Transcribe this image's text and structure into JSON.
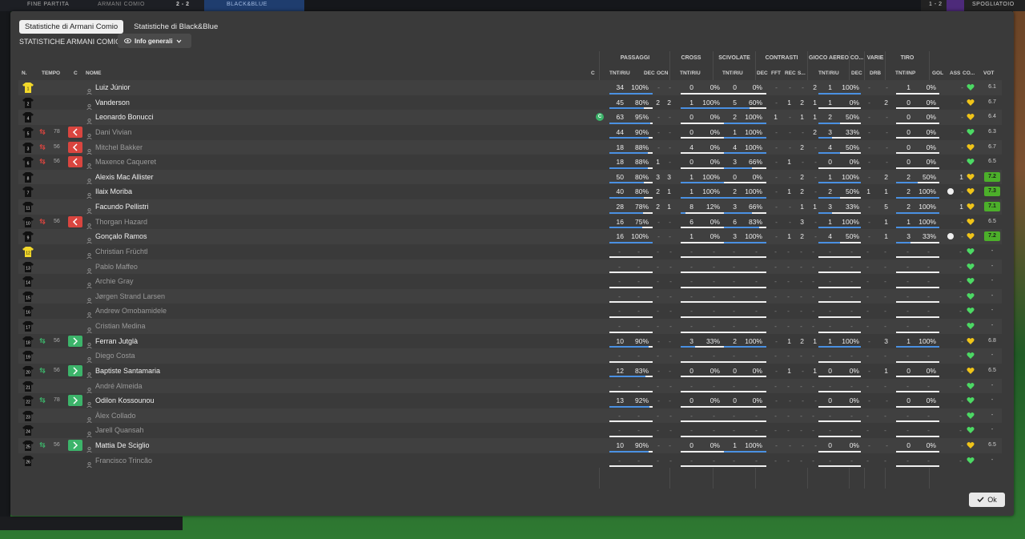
{
  "topbar": {
    "left_label": "FINE PARTITA",
    "team_a": "ARMANI COMIO",
    "score": "2 - 2",
    "team_b": "BLACK&BLUE",
    "right_score": "1 - 2",
    "right_label": "SPOGLIATOIO"
  },
  "tabs": [
    {
      "label": "Statistiche di Armani Comio",
      "active": true
    },
    {
      "label": "Statistiche di Black&Blue",
      "active": false
    }
  ],
  "subtitle": "STATISTICHE ARMANI COMIO",
  "dropdown": {
    "label": "Info generali"
  },
  "headers": {
    "groups": {
      "passaggi": "PASSAGGI",
      "cross": "CROSS",
      "scivolate": "SCIVOLATE",
      "contrasti": "CONTRASTI",
      "gioco_aereo": "GIOCO AEREO",
      "co": "CO...",
      "varie": "VARIE",
      "tiro": "TIRO"
    },
    "cols": {
      "n": "N.",
      "tempo": "TEMPO",
      "c": "C",
      "nome": "NOME",
      "cap": "C",
      "pas_tnt": "TNT/RIU",
      "pas_dec": "DEC",
      "pas_ocn": "OCN",
      "cross_tnt": "TNT/RIU",
      "sci_tnt": "TNT/RIU",
      "con_dec": "DEC",
      "con_fft": "FFT",
      "con_rec": "REC",
      "con_s": "S...",
      "aer_tnt": "TNT/RIU",
      "co_dec": "DEC",
      "var_drb": "DRB",
      "tiro_tnt": "TNT/INP",
      "gol": "GOL",
      "ass": "ASS",
      "cond": "CO...",
      "vot": "VOT"
    }
  },
  "players": [
    {
      "num": "1",
      "tempo": "",
      "change": "",
      "name": "Luiz Júnior",
      "gk": true,
      "captain": false,
      "pas": [
        "34",
        "100%",
        100
      ],
      "pas_dec": "-",
      "pas_ocn": "-",
      "cross": [
        "0",
        "0%",
        0
      ],
      "sci": [
        "0",
        "0%",
        0
      ],
      "con": [
        "-",
        "-",
        "-",
        "2"
      ],
      "aer": [
        "1",
        "100%",
        100
      ],
      "co_dec": "-",
      "drb": "-",
      "tiro": [
        "1",
        "0%",
        0
      ],
      "gol": "",
      "ass": "-",
      "vot": "6.1",
      "hi": false,
      "ball": false,
      "bench": false
    },
    {
      "num": "2",
      "tempo": "",
      "change": "",
      "name": "Vanderson",
      "gk": false,
      "captain": false,
      "pas": [
        "45",
        "80%",
        80
      ],
      "pas_dec": "2",
      "pas_ocn": "2",
      "cross": [
        "1",
        "100%",
        100
      ],
      "sci": [
        "5",
        "60%",
        60
      ],
      "con": [
        "-",
        "1",
        "2",
        "1"
      ],
      "aer": [
        "1",
        "0%",
        0
      ],
      "co_dec": "-",
      "drb": "2",
      "tiro": [
        "0",
        "0%",
        0
      ],
      "gol": "",
      "ass": "-",
      "vot": "6.7",
      "hi": false,
      "ball": false,
      "bench": false
    },
    {
      "num": "4",
      "tempo": "",
      "change": "",
      "name": "Leonardo Bonucci",
      "gk": false,
      "captain": true,
      "pas": [
        "63",
        "95%",
        95
      ],
      "pas_dec": "-",
      "pas_ocn": "-",
      "cross": [
        "0",
        "0%",
        0
      ],
      "sci": [
        "2",
        "100%",
        100
      ],
      "con": [
        "1",
        "-",
        "1",
        "1"
      ],
      "aer": [
        "2",
        "50%",
        50
      ],
      "co_dec": "-",
      "drb": "-",
      "tiro": [
        "0",
        "0%",
        0
      ],
      "gol": "",
      "ass": "-",
      "vot": "6.4",
      "hi": false,
      "ball": false,
      "bench": false
    },
    {
      "num": "5",
      "tempo": "78",
      "change": "out",
      "name": "Dani Vivian",
      "gk": false,
      "captain": false,
      "pas": [
        "44",
        "90%",
        90
      ],
      "pas_dec": "-",
      "pas_ocn": "-",
      "cross": [
        "0",
        "0%",
        0
      ],
      "sci": [
        "1",
        "100%",
        100
      ],
      "con": [
        "-",
        "-",
        "-",
        "2"
      ],
      "aer": [
        "3",
        "33%",
        33
      ],
      "co_dec": "-",
      "drb": "-",
      "tiro": [
        "0",
        "0%",
        0
      ],
      "gol": "",
      "ass": "-",
      "vot": "6.3",
      "hi": false,
      "ball": false,
      "bench": false,
      "dim": true
    },
    {
      "num": "3",
      "tempo": "56",
      "change": "out",
      "name": "Mitchel Bakker",
      "gk": false,
      "captain": false,
      "pas": [
        "18",
        "88%",
        88
      ],
      "pas_dec": "-",
      "pas_ocn": "-",
      "cross": [
        "4",
        "0%",
        0
      ],
      "sci": [
        "4",
        "100%",
        100
      ],
      "con": [
        "-",
        "-",
        "2",
        "-"
      ],
      "aer": [
        "4",
        "50%",
        50
      ],
      "co_dec": "-",
      "drb": "-",
      "tiro": [
        "0",
        "0%",
        0
      ],
      "gol": "",
      "ass": "-",
      "vot": "6.7",
      "hi": false,
      "ball": false,
      "bench": false,
      "dim": true
    },
    {
      "num": "6",
      "tempo": "56",
      "change": "out",
      "name": "Maxence Caqueret",
      "gk": false,
      "captain": false,
      "pas": [
        "18",
        "88%",
        88
      ],
      "pas_dec": "1",
      "pas_ocn": "-",
      "cross": [
        "0",
        "0%",
        0
      ],
      "sci": [
        "3",
        "66%",
        66
      ],
      "con": [
        "-",
        "1",
        "-",
        "-"
      ],
      "aer": [
        "0",
        "0%",
        0
      ],
      "co_dec": "-",
      "drb": "-",
      "tiro": [
        "0",
        "0%",
        0
      ],
      "gol": "",
      "ass": "-",
      "vot": "6.5",
      "hi": false,
      "ball": false,
      "bench": false,
      "dim": true
    },
    {
      "num": "8",
      "tempo": "",
      "change": "",
      "name": "Alexis Mac Allister",
      "gk": false,
      "captain": false,
      "pas": [
        "50",
        "80%",
        80
      ],
      "pas_dec": "3",
      "pas_ocn": "3",
      "cross": [
        "1",
        "100%",
        100
      ],
      "sci": [
        "0",
        "0%",
        0
      ],
      "con": [
        "-",
        "-",
        "2",
        "-"
      ],
      "aer": [
        "1",
        "100%",
        100
      ],
      "co_dec": "-",
      "drb": "2",
      "tiro": [
        "2",
        "50%",
        50
      ],
      "gol": "",
      "ass": "1",
      "vot": "7.2",
      "hi": true,
      "ball": false,
      "bench": false
    },
    {
      "num": "7",
      "tempo": "",
      "change": "",
      "name": "Ilaix Moriba",
      "gk": false,
      "captain": false,
      "pas": [
        "40",
        "80%",
        80
      ],
      "pas_dec": "2",
      "pas_ocn": "1",
      "cross": [
        "1",
        "100%",
        100
      ],
      "sci": [
        "2",
        "100%",
        100
      ],
      "con": [
        "-",
        "1",
        "2",
        "-"
      ],
      "aer": [
        "2",
        "50%",
        50
      ],
      "co_dec": "1",
      "drb": "1",
      "tiro": [
        "2",
        "100%",
        100
      ],
      "gol": "",
      "ass": "-",
      "vot": "7.3",
      "hi": true,
      "ball": true,
      "bench": false
    },
    {
      "num": "11",
      "tempo": "",
      "change": "",
      "name": "Facundo Pellistri",
      "gk": false,
      "captain": false,
      "pas": [
        "28",
        "78%",
        78
      ],
      "pas_dec": "2",
      "pas_ocn": "1",
      "cross": [
        "8",
        "12%",
        12
      ],
      "sci": [
        "3",
        "66%",
        66
      ],
      "con": [
        "-",
        "-",
        "1",
        "1"
      ],
      "aer": [
        "3",
        "33%",
        33
      ],
      "co_dec": "-",
      "drb": "5",
      "tiro": [
        "2",
        "100%",
        100
      ],
      "gol": "",
      "ass": "1",
      "vot": "7.1",
      "hi": true,
      "ball": false,
      "bench": false
    },
    {
      "num": "10",
      "tempo": "56",
      "change": "out",
      "name": "Thorgan Hazard",
      "gk": false,
      "captain": false,
      "pas": [
        "16",
        "75%",
        75
      ],
      "pas_dec": "-",
      "pas_ocn": "-",
      "cross": [
        "6",
        "0%",
        0
      ],
      "sci": [
        "6",
        "83%",
        83
      ],
      "con": [
        "-",
        "-",
        "3",
        "-"
      ],
      "aer": [
        "1",
        "100%",
        100
      ],
      "co_dec": "-",
      "drb": "1",
      "tiro": [
        "1",
        "100%",
        100
      ],
      "gol": "",
      "ass": "-",
      "vot": "6.5",
      "hi": false,
      "ball": false,
      "bench": false,
      "dim": true
    },
    {
      "num": "9",
      "tempo": "",
      "change": "",
      "name": "Gonçalo Ramos",
      "gk": false,
      "captain": false,
      "pas": [
        "16",
        "100%",
        100
      ],
      "pas_dec": "-",
      "pas_ocn": "-",
      "cross": [
        "1",
        "0%",
        0
      ],
      "sci": [
        "3",
        "100%",
        100
      ],
      "con": [
        "-",
        "1",
        "2",
        "-"
      ],
      "aer": [
        "4",
        "50%",
        50
      ],
      "co_dec": "-",
      "drb": "1",
      "tiro": [
        "3",
        "33%",
        33
      ],
      "gol": "",
      "ass": "-",
      "vot": "7.2",
      "hi": true,
      "ball": true,
      "bench": false
    },
    {
      "num": "12",
      "tempo": "",
      "change": "",
      "name": "Christian Früchtl",
      "gk": true,
      "bench": true
    },
    {
      "num": "13",
      "tempo": "",
      "change": "",
      "name": "Pablo Maffeo",
      "bench": true
    },
    {
      "num": "14",
      "tempo": "",
      "change": "",
      "name": "Archie Gray",
      "bench": true
    },
    {
      "num": "15",
      "tempo": "",
      "change": "",
      "name": "Jørgen Strand Larsen",
      "bench": true
    },
    {
      "num": "16",
      "tempo": "",
      "change": "",
      "name": "Andrew Omobamidele",
      "bench": true
    },
    {
      "num": "17",
      "tempo": "",
      "change": "",
      "name": "Cristian Medina",
      "bench": true
    },
    {
      "num": "18",
      "tempo": "56",
      "change": "in",
      "name": "Ferran Jutglà",
      "gk": false,
      "captain": false,
      "pas": [
        "10",
        "90%",
        90
      ],
      "pas_dec": "-",
      "pas_ocn": "-",
      "cross": [
        "3",
        "33%",
        33
      ],
      "sci": [
        "2",
        "100%",
        100
      ],
      "con": [
        "-",
        "1",
        "2",
        "1"
      ],
      "aer": [
        "1",
        "100%",
        100
      ],
      "co_dec": "-",
      "drb": "3",
      "tiro": [
        "1",
        "100%",
        100
      ],
      "gol": "",
      "ass": "-",
      "vot": "6.8",
      "hi": false,
      "ball": false,
      "bench": false
    },
    {
      "num": "19",
      "tempo": "",
      "change": "",
      "name": "Diego Costa",
      "bench": true
    },
    {
      "num": "20",
      "tempo": "56",
      "change": "in",
      "name": "Baptiste Santamaria",
      "gk": false,
      "captain": false,
      "pas": [
        "12",
        "83%",
        83
      ],
      "pas_dec": "-",
      "pas_ocn": "-",
      "cross": [
        "0",
        "0%",
        0
      ],
      "sci": [
        "0",
        "0%",
        0
      ],
      "con": [
        "-",
        "1",
        "-",
        "1"
      ],
      "aer": [
        "0",
        "0%",
        0
      ],
      "co_dec": "-",
      "drb": "1",
      "tiro": [
        "0",
        "0%",
        0
      ],
      "gol": "",
      "ass": "-",
      "vot": "6.5",
      "hi": false,
      "ball": false,
      "bench": false
    },
    {
      "num": "21",
      "tempo": "",
      "change": "",
      "name": "André Almeida",
      "bench": true
    },
    {
      "num": "22",
      "tempo": "78",
      "change": "in",
      "name": "Odilon Kossounou",
      "gk": false,
      "captain": false,
      "pas": [
        "13",
        "92%",
        92
      ],
      "pas_dec": "-",
      "pas_ocn": "-",
      "cross": [
        "0",
        "0%",
        0
      ],
      "sci": [
        "0",
        "0%",
        0
      ],
      "con": [
        "-",
        "-",
        "-",
        "-"
      ],
      "aer": [
        "0",
        "0%",
        0
      ],
      "co_dec": "-",
      "drb": "-",
      "tiro": [
        "0",
        "0%",
        0
      ],
      "gol": "",
      "ass": "-",
      "vot": "-",
      "hi": false,
      "ball": false,
      "bench": false
    },
    {
      "num": "23",
      "tempo": "",
      "change": "",
      "name": "Àlex Collado",
      "bench": true
    },
    {
      "num": "24",
      "tempo": "",
      "change": "",
      "name": "Jarell Quansah",
      "bench": true
    },
    {
      "num": "25",
      "tempo": "56",
      "change": "in",
      "name": "Mattia De Sciglio",
      "gk": false,
      "captain": false,
      "pas": [
        "10",
        "90%",
        90
      ],
      "pas_dec": "-",
      "pas_ocn": "-",
      "cross": [
        "0",
        "0%",
        0
      ],
      "sci": [
        "1",
        "100%",
        100
      ],
      "con": [
        "-",
        "-",
        "-",
        "-"
      ],
      "aer": [
        "0",
        "0%",
        0
      ],
      "co_dec": "-",
      "drb": "-",
      "tiro": [
        "0",
        "0%",
        0
      ],
      "gol": "",
      "ass": "-",
      "vot": "6.5",
      "hi": false,
      "ball": false,
      "bench": false
    },
    {
      "num": "26",
      "tempo": "",
      "change": "",
      "name": "Francisco Trincão",
      "bench": true
    }
  ],
  "captain_badge": "C",
  "ok_button": {
    "label": "Ok"
  },
  "colors": {
    "bar_fill": "#4a90e2",
    "heart_green": "#4cd964",
    "heart_yellow": "#f0c419",
    "vote_hi": "#4caf2a",
    "sub_out": "#d9453f",
    "sub_in": "#3cb46a",
    "gk_shirt": "#f2d82a"
  }
}
